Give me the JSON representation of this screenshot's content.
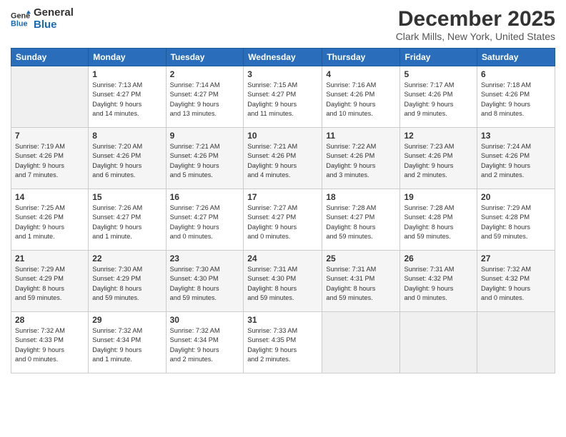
{
  "logo": {
    "line1": "General",
    "line2": "Blue"
  },
  "title": "December 2025",
  "subtitle": "Clark Mills, New York, United States",
  "header_days": [
    "Sunday",
    "Monday",
    "Tuesday",
    "Wednesday",
    "Thursday",
    "Friday",
    "Saturday"
  ],
  "weeks": [
    [
      {
        "day": "",
        "info": ""
      },
      {
        "day": "1",
        "info": "Sunrise: 7:13 AM\nSunset: 4:27 PM\nDaylight: 9 hours\nand 14 minutes."
      },
      {
        "day": "2",
        "info": "Sunrise: 7:14 AM\nSunset: 4:27 PM\nDaylight: 9 hours\nand 13 minutes."
      },
      {
        "day": "3",
        "info": "Sunrise: 7:15 AM\nSunset: 4:27 PM\nDaylight: 9 hours\nand 11 minutes."
      },
      {
        "day": "4",
        "info": "Sunrise: 7:16 AM\nSunset: 4:26 PM\nDaylight: 9 hours\nand 10 minutes."
      },
      {
        "day": "5",
        "info": "Sunrise: 7:17 AM\nSunset: 4:26 PM\nDaylight: 9 hours\nand 9 minutes."
      },
      {
        "day": "6",
        "info": "Sunrise: 7:18 AM\nSunset: 4:26 PM\nDaylight: 9 hours\nand 8 minutes."
      }
    ],
    [
      {
        "day": "7",
        "info": "Sunrise: 7:19 AM\nSunset: 4:26 PM\nDaylight: 9 hours\nand 7 minutes."
      },
      {
        "day": "8",
        "info": "Sunrise: 7:20 AM\nSunset: 4:26 PM\nDaylight: 9 hours\nand 6 minutes."
      },
      {
        "day": "9",
        "info": "Sunrise: 7:21 AM\nSunset: 4:26 PM\nDaylight: 9 hours\nand 5 minutes."
      },
      {
        "day": "10",
        "info": "Sunrise: 7:21 AM\nSunset: 4:26 PM\nDaylight: 9 hours\nand 4 minutes."
      },
      {
        "day": "11",
        "info": "Sunrise: 7:22 AM\nSunset: 4:26 PM\nDaylight: 9 hours\nand 3 minutes."
      },
      {
        "day": "12",
        "info": "Sunrise: 7:23 AM\nSunset: 4:26 PM\nDaylight: 9 hours\nand 2 minutes."
      },
      {
        "day": "13",
        "info": "Sunrise: 7:24 AM\nSunset: 4:26 PM\nDaylight: 9 hours\nand 2 minutes."
      }
    ],
    [
      {
        "day": "14",
        "info": "Sunrise: 7:25 AM\nSunset: 4:26 PM\nDaylight: 9 hours\nand 1 minute."
      },
      {
        "day": "15",
        "info": "Sunrise: 7:26 AM\nSunset: 4:27 PM\nDaylight: 9 hours\nand 1 minute."
      },
      {
        "day": "16",
        "info": "Sunrise: 7:26 AM\nSunset: 4:27 PM\nDaylight: 9 hours\nand 0 minutes."
      },
      {
        "day": "17",
        "info": "Sunrise: 7:27 AM\nSunset: 4:27 PM\nDaylight: 9 hours\nand 0 minutes."
      },
      {
        "day": "18",
        "info": "Sunrise: 7:28 AM\nSunset: 4:27 PM\nDaylight: 8 hours\nand 59 minutes."
      },
      {
        "day": "19",
        "info": "Sunrise: 7:28 AM\nSunset: 4:28 PM\nDaylight: 8 hours\nand 59 minutes."
      },
      {
        "day": "20",
        "info": "Sunrise: 7:29 AM\nSunset: 4:28 PM\nDaylight: 8 hours\nand 59 minutes."
      }
    ],
    [
      {
        "day": "21",
        "info": "Sunrise: 7:29 AM\nSunset: 4:29 PM\nDaylight: 8 hours\nand 59 minutes."
      },
      {
        "day": "22",
        "info": "Sunrise: 7:30 AM\nSunset: 4:29 PM\nDaylight: 8 hours\nand 59 minutes."
      },
      {
        "day": "23",
        "info": "Sunrise: 7:30 AM\nSunset: 4:30 PM\nDaylight: 8 hours\nand 59 minutes."
      },
      {
        "day": "24",
        "info": "Sunrise: 7:31 AM\nSunset: 4:30 PM\nDaylight: 8 hours\nand 59 minutes."
      },
      {
        "day": "25",
        "info": "Sunrise: 7:31 AM\nSunset: 4:31 PM\nDaylight: 8 hours\nand 59 minutes."
      },
      {
        "day": "26",
        "info": "Sunrise: 7:31 AM\nSunset: 4:32 PM\nDaylight: 9 hours\nand 0 minutes."
      },
      {
        "day": "27",
        "info": "Sunrise: 7:32 AM\nSunset: 4:32 PM\nDaylight: 9 hours\nand 0 minutes."
      }
    ],
    [
      {
        "day": "28",
        "info": "Sunrise: 7:32 AM\nSunset: 4:33 PM\nDaylight: 9 hours\nand 0 minutes."
      },
      {
        "day": "29",
        "info": "Sunrise: 7:32 AM\nSunset: 4:34 PM\nDaylight: 9 hours\nand 1 minute."
      },
      {
        "day": "30",
        "info": "Sunrise: 7:32 AM\nSunset: 4:34 PM\nDaylight: 9 hours\nand 2 minutes."
      },
      {
        "day": "31",
        "info": "Sunrise: 7:33 AM\nSunset: 4:35 PM\nDaylight: 9 hours\nand 2 minutes."
      },
      {
        "day": "",
        "info": ""
      },
      {
        "day": "",
        "info": ""
      },
      {
        "day": "",
        "info": ""
      }
    ]
  ]
}
